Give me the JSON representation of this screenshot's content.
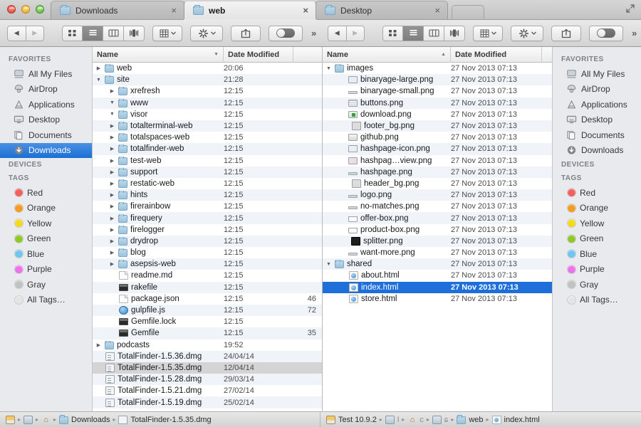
{
  "window": {
    "traffic_lights": [
      "close",
      "minimize",
      "zoom"
    ],
    "fullscreen_label": "Enter Full Screen"
  },
  "tabs": [
    {
      "label": "Downloads",
      "icon": "folder-icon",
      "active": false,
      "close": "×"
    },
    {
      "label": "web",
      "icon": "folder-icon",
      "active": true,
      "close": "×"
    },
    {
      "label": "Desktop",
      "icon": "folder-icon",
      "active": false,
      "close": "×"
    }
  ],
  "toolbar": {
    "back_label": "◀",
    "forward_label": "▶",
    "view_modes": [
      {
        "name": "icon-view",
        "selected": false
      },
      {
        "name": "list-view",
        "selected": true
      },
      {
        "name": "column-view",
        "selected": false
      },
      {
        "name": "coverflow-view",
        "selected": false
      }
    ],
    "arrange_label": "Arrange",
    "action_label": "Action",
    "share_label": "Share",
    "toggle_label": "Dual mode",
    "overflow_label": "»"
  },
  "sidebar": {
    "sections": [
      {
        "header": "FAVORITES",
        "items": [
          {
            "label": "All My Files",
            "icon": "all-my-files-icon",
            "selected_left": false
          },
          {
            "label": "AirDrop",
            "icon": "airdrop-icon",
            "selected_left": false
          },
          {
            "label": "Applications",
            "icon": "applications-icon",
            "selected_left": false
          },
          {
            "label": "Desktop",
            "icon": "desktop-icon",
            "selected_left": false
          },
          {
            "label": "Documents",
            "icon": "documents-icon",
            "selected_left": false
          },
          {
            "label": "Downloads",
            "icon": "downloads-icon",
            "selected_left": true
          }
        ]
      },
      {
        "header": "DEVICES",
        "items": []
      },
      {
        "header": "TAGS",
        "items": [
          {
            "label": "Red",
            "icon": "tag-dot-icon",
            "color": "#f2625d"
          },
          {
            "label": "Orange",
            "icon": "tag-dot-icon",
            "color": "#f59b1f"
          },
          {
            "label": "Yellow",
            "icon": "tag-dot-icon",
            "color": "#f3da1a"
          },
          {
            "label": "Green",
            "icon": "tag-dot-icon",
            "color": "#8ec927"
          },
          {
            "label": "Blue",
            "icon": "tag-dot-icon",
            "color": "#6fc6ef"
          },
          {
            "label": "Purple",
            "icon": "tag-dot-icon",
            "color": "#ec73ea"
          },
          {
            "label": "Gray",
            "icon": "tag-dot-icon",
            "color": "#c2c2c2"
          },
          {
            "label": "All Tags…",
            "icon": "all-tags-icon",
            "color": "#e4e4e4"
          }
        ]
      }
    ]
  },
  "left_pane": {
    "columns": [
      {
        "label": "Name",
        "sort": "desc"
      },
      {
        "label": "Date Modified",
        "sort": "none"
      },
      {
        "label": "",
        "sort": "none"
      }
    ],
    "rows": [
      {
        "name": "web",
        "date": "20:06",
        "size": "",
        "icon": "folder-icon",
        "indent": 0,
        "twisty": "collapsed",
        "state": "none"
      },
      {
        "name": "site",
        "date": "21:28",
        "size": "",
        "icon": "folder-icon",
        "indent": 0,
        "twisty": "expanded",
        "state": "none"
      },
      {
        "name": "xrefresh",
        "date": "12:15",
        "size": "",
        "icon": "folder-icon",
        "indent": 1,
        "twisty": "collapsed",
        "state": "none"
      },
      {
        "name": "www",
        "date": "12:15",
        "size": "",
        "icon": "folder-icon",
        "indent": 1,
        "twisty": "expanded",
        "state": "none"
      },
      {
        "name": "visor",
        "date": "12:15",
        "size": "",
        "icon": "folder-icon",
        "indent": 1,
        "twisty": "expanded",
        "state": "none"
      },
      {
        "name": "totalterminal-web",
        "date": "12:15",
        "size": "",
        "icon": "folder-icon",
        "indent": 1,
        "twisty": "collapsed",
        "state": "none"
      },
      {
        "name": "totalspaces-web",
        "date": "12:15",
        "size": "",
        "icon": "folder-icon",
        "indent": 1,
        "twisty": "collapsed",
        "state": "none"
      },
      {
        "name": "totalfinder-web",
        "date": "12:15",
        "size": "",
        "icon": "folder-icon",
        "indent": 1,
        "twisty": "collapsed",
        "state": "none"
      },
      {
        "name": "test-web",
        "date": "12:15",
        "size": "",
        "icon": "folder-icon",
        "indent": 1,
        "twisty": "collapsed",
        "state": "none"
      },
      {
        "name": "support",
        "date": "12:15",
        "size": "",
        "icon": "folder-icon",
        "indent": 1,
        "twisty": "collapsed",
        "state": "none"
      },
      {
        "name": "restatic-web",
        "date": "12:15",
        "size": "",
        "icon": "folder-icon",
        "indent": 1,
        "twisty": "collapsed",
        "state": "none"
      },
      {
        "name": "hints",
        "date": "12:15",
        "size": "",
        "icon": "folder-icon",
        "indent": 1,
        "twisty": "collapsed",
        "state": "none"
      },
      {
        "name": "firerainbow",
        "date": "12:15",
        "size": "",
        "icon": "folder-icon",
        "indent": 1,
        "twisty": "collapsed",
        "state": "none"
      },
      {
        "name": "firequery",
        "date": "12:15",
        "size": "",
        "icon": "folder-icon",
        "indent": 1,
        "twisty": "collapsed",
        "state": "none"
      },
      {
        "name": "firelogger",
        "date": "12:15",
        "size": "",
        "icon": "folder-icon",
        "indent": 1,
        "twisty": "collapsed",
        "state": "none"
      },
      {
        "name": "drydrop",
        "date": "12:15",
        "size": "",
        "icon": "folder-icon",
        "indent": 1,
        "twisty": "collapsed",
        "state": "none"
      },
      {
        "name": "blog",
        "date": "12:15",
        "size": "",
        "icon": "folder-icon",
        "indent": 1,
        "twisty": "collapsed",
        "state": "none"
      },
      {
        "name": "asepsis-web",
        "date": "12:15",
        "size": "",
        "icon": "folder-icon",
        "indent": 1,
        "twisty": "collapsed",
        "state": "none"
      },
      {
        "name": "readme.md",
        "date": "12:15",
        "size": "",
        "icon": "document-icon",
        "indent": 1,
        "twisty": "none",
        "state": "none"
      },
      {
        "name": "rakefile",
        "date": "12:15",
        "size": "",
        "icon": "executable-icon",
        "indent": 1,
        "twisty": "none",
        "state": "none"
      },
      {
        "name": "package.json",
        "date": "12:15",
        "size": "46",
        "icon": "document-icon",
        "indent": 1,
        "twisty": "none",
        "state": "none"
      },
      {
        "name": "gulpfile.js",
        "date": "12:15",
        "size": "72",
        "icon": "js-icon",
        "indent": 1,
        "twisty": "none",
        "state": "none"
      },
      {
        "name": "Gemfile.lock",
        "date": "12:15",
        "size": "",
        "icon": "executable-icon",
        "indent": 1,
        "twisty": "none",
        "state": "none"
      },
      {
        "name": "Gemfile",
        "date": "12:15",
        "size": "35",
        "icon": "executable-icon",
        "indent": 1,
        "twisty": "none",
        "state": "none"
      },
      {
        "name": "podcasts",
        "date": "19:52",
        "size": "",
        "icon": "folder-icon",
        "indent": 0,
        "twisty": "collapsed",
        "state": "none"
      },
      {
        "name": "TotalFinder-1.5.36.dmg",
        "date": "24/04/14",
        "size": "",
        "icon": "dmg-icon",
        "indent": 0,
        "twisty": "none",
        "state": "none"
      },
      {
        "name": "TotalFinder-1.5.35.dmg",
        "date": "12/04/14",
        "size": "",
        "icon": "dmg-icon",
        "indent": 0,
        "twisty": "none",
        "state": "selected-inactive"
      },
      {
        "name": "TotalFinder-1.5.28.dmg",
        "date": "29/03/14",
        "size": "",
        "icon": "dmg-icon",
        "indent": 0,
        "twisty": "none",
        "state": "none"
      },
      {
        "name": "TotalFinder-1.5.21.dmg",
        "date": "27/02/14",
        "size": "",
        "icon": "dmg-icon",
        "indent": 0,
        "twisty": "none",
        "state": "none"
      },
      {
        "name": "TotalFinder-1.5.19.dmg",
        "date": "25/02/14",
        "size": "",
        "icon": "dmg-icon",
        "indent": 0,
        "twisty": "none",
        "state": "none"
      }
    ]
  },
  "right_pane": {
    "columns": [
      {
        "label": "Name",
        "sort": "asc"
      },
      {
        "label": "Date Modified",
        "sort": "none"
      },
      {
        "label": "",
        "sort": "none"
      }
    ],
    "rows": [
      {
        "name": "images",
        "date": "27 Nov 2013 07:13",
        "icon": "folder-icon",
        "indent": 0,
        "twisty": "expanded",
        "state": "none"
      },
      {
        "name": "binaryage-large.png",
        "date": "27 Nov 2013 07:13",
        "icon": "image-icon",
        "indent": 1,
        "twisty": "none",
        "state": "none"
      },
      {
        "name": "binaryage-small.png",
        "date": "27 Nov 2013 07:13",
        "icon": "image-thin-icon",
        "indent": 1,
        "twisty": "none",
        "state": "none"
      },
      {
        "name": "buttons.png",
        "date": "27 Nov 2013 07:13",
        "icon": "image-lines-icon",
        "indent": 1,
        "twisty": "none",
        "state": "none"
      },
      {
        "name": "download.png",
        "date": "27 Nov 2013 07:13",
        "icon": "image-green-icon",
        "indent": 1,
        "twisty": "none",
        "state": "none"
      },
      {
        "name": "footer_bg.png",
        "date": "27 Nov 2013 07:13",
        "icon": "image-bar-icon",
        "indent": 1,
        "twisty": "none",
        "state": "none"
      },
      {
        "name": "github.png",
        "date": "27 Nov 2013 07:13",
        "icon": "image-gh-icon",
        "indent": 1,
        "twisty": "none",
        "state": "none"
      },
      {
        "name": "hashpage-icon.png",
        "date": "27 Nov 2013 07:13",
        "icon": "image-icon",
        "indent": 1,
        "twisty": "none",
        "state": "none"
      },
      {
        "name": "hashpag…view.png",
        "date": "27 Nov 2013 07:13",
        "icon": "image-shot-icon",
        "indent": 1,
        "twisty": "none",
        "state": "none"
      },
      {
        "name": "hashpage.png",
        "date": "27 Nov 2013 07:13",
        "icon": "image-thin-icon",
        "indent": 1,
        "twisty": "none",
        "state": "none"
      },
      {
        "name": "header_bg.png",
        "date": "27 Nov 2013 07:13",
        "icon": "image-bar-icon",
        "indent": 1,
        "twisty": "none",
        "state": "none"
      },
      {
        "name": "logo.png",
        "date": "27 Nov 2013 07:13",
        "icon": "image-thin-icon",
        "indent": 1,
        "twisty": "none",
        "state": "none"
      },
      {
        "name": "no-matches.png",
        "date": "27 Nov 2013 07:13",
        "icon": "image-thin-icon",
        "indent": 1,
        "twisty": "none",
        "state": "none"
      },
      {
        "name": "offer-box.png",
        "date": "27 Nov 2013 07:13",
        "icon": "image-box-icon",
        "indent": 1,
        "twisty": "none",
        "state": "none"
      },
      {
        "name": "product-box.png",
        "date": "27 Nov 2013 07:13",
        "icon": "image-box-icon",
        "indent": 1,
        "twisty": "none",
        "state": "none"
      },
      {
        "name": "splitter.png",
        "date": "27 Nov 2013 07:13",
        "icon": "image-barblack-icon",
        "indent": 1,
        "twisty": "none",
        "state": "none"
      },
      {
        "name": "want-more.png",
        "date": "27 Nov 2013 07:13",
        "icon": "image-thin-icon",
        "indent": 1,
        "twisty": "none",
        "state": "none"
      },
      {
        "name": "shared",
        "date": "27 Nov 2013 07:13",
        "icon": "folder-icon",
        "indent": 0,
        "twisty": "expanded",
        "state": "none"
      },
      {
        "name": "about.html",
        "date": "27 Nov 2013 07:13",
        "icon": "html-icon",
        "indent": 1,
        "twisty": "none",
        "state": "none"
      },
      {
        "name": "index.html",
        "date": "27 Nov 2013 07:13",
        "icon": "html-icon",
        "indent": 1,
        "twisty": "none",
        "state": "selected-active"
      },
      {
        "name": "store.html",
        "date": "27 Nov 2013 07:13",
        "icon": "html-icon",
        "indent": 1,
        "twisty": "none",
        "state": "none"
      }
    ]
  },
  "path_bar": {
    "left": [
      {
        "label": "",
        "icon": "hard-disk-icon"
      },
      {
        "label": "",
        "icon": "mac-icon"
      },
      {
        "label": "",
        "icon": "home-icon"
      },
      {
        "label": "Downloads",
        "icon": "folder-icon"
      },
      {
        "label": "TotalFinder-1.5.35.dmg",
        "icon": "dmg-icon"
      }
    ],
    "right": [
      {
        "label": "Test 10.9.2",
        "icon": "hard-disk-icon"
      },
      {
        "label": "l",
        "icon": "mac-icon"
      },
      {
        "label": "c",
        "icon": "home-icon"
      },
      {
        "label": "ɕ",
        "icon": "mac-icon"
      },
      {
        "label": "web",
        "icon": "folder-icon"
      },
      {
        "label": "index.html",
        "icon": "html-icon"
      }
    ],
    "separator": "▸"
  },
  "colors": {
    "selection_blue": "#1e6fd9",
    "selection_gray": "#d4d4d4",
    "stripe": "#f0f4f9",
    "sidebar_bg": "#e8eaed",
    "toolbar_bg": "#e0e0e0"
  }
}
